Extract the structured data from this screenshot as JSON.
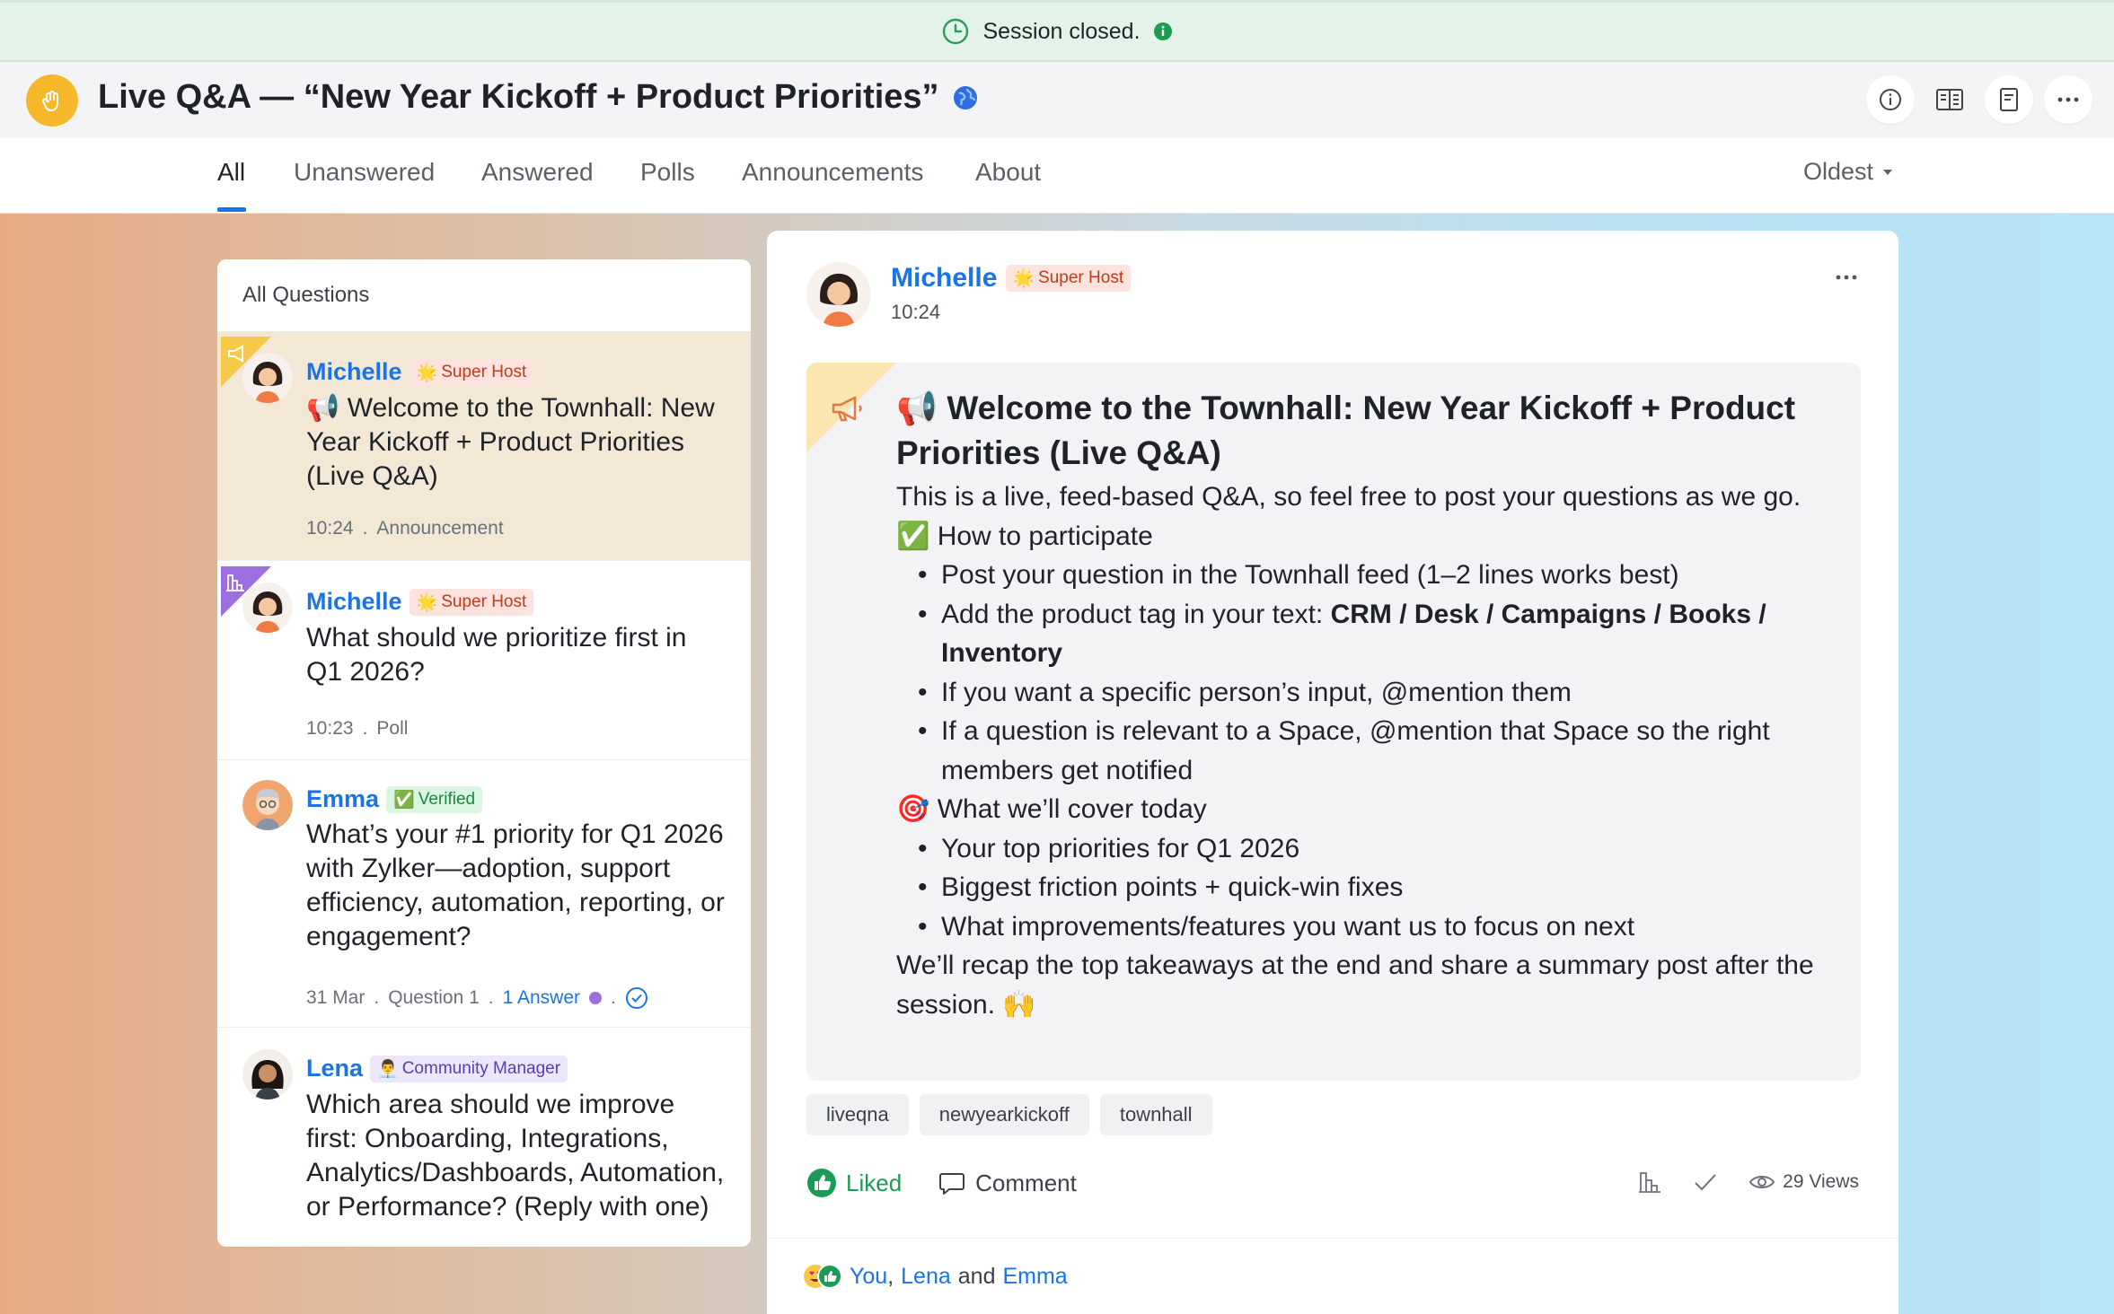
{
  "banner": {
    "text": "Session closed."
  },
  "header": {
    "title": "Live Q&A — “New Year Kickoff + Product Priorities”"
  },
  "tabs": [
    {
      "label": "All",
      "active": true
    },
    {
      "label": "Unanswered"
    },
    {
      "label": "Answered"
    },
    {
      "label": "Polls"
    },
    {
      "label": "Announcements"
    },
    {
      "label": "About"
    }
  ],
  "sort": {
    "label": "Oldest"
  },
  "questions_panel": {
    "heading": "All Questions",
    "items": [
      {
        "author": "Michelle",
        "badge": "Super Host",
        "text": "📢 Welcome to the Townhall: New Year Kickoff + Product Priorities (Live Q&A)",
        "time": "10:24",
        "type": "Announcement"
      },
      {
        "author": "Michelle",
        "badge": "Super Host",
        "text": "What should we prioritize first in Q1 2026?",
        "time": "10:23",
        "type": "Poll"
      },
      {
        "author": "Emma",
        "badge": "Verified",
        "text": "What’s your #1 priority for Q1 2026 with Zylker—adoption, support efficiency, automation, reporting, or engagement?",
        "time": "31 Mar",
        "type": "Question 1",
        "answers": "1 Answer"
      },
      {
        "author": "Lena",
        "badge": "Community Manager",
        "text": "Which area should we improve first: Onboarding, Integrations, Analytics/Dashboards, Automation, or Performance? (Reply with one)"
      }
    ]
  },
  "detail": {
    "author": "Michelle",
    "badge": "Super Host",
    "time": "10:24",
    "title": "📢 Welcome to the Townhall: New Year Kickoff + Product Priorities (Live Q&A)",
    "intro": "This is a live, feed-based Q&A, so feel free to post your questions as we go.",
    "participate_heading": "✅ How to participate",
    "participate_items": {
      "p1": "Post your question in the Townhall feed (1–2 lines works best)",
      "p2_prefix": "Add the product tag in your text: ",
      "p2_bold": "CRM / Desk / Campaigns / Books / Inventory",
      "p3": "If you want a specific person’s input, @mention them",
      "p4": "If a question is relevant to a Space, @mention that Space so the right members get notified"
    },
    "cover_heading": "🎯 What we’ll cover today",
    "cover_items": [
      "Your top priorities for Q1 2026",
      "Biggest friction points + quick-win fixes",
      "What improvements/features you want us to focus on next"
    ],
    "outro": "We’ll recap the top takeaways at the end and share a summary post after the session. 🙌",
    "tags": [
      "liveqna",
      "newyearkickoff",
      "townhall"
    ],
    "like_label": "Liked",
    "comment_label": "Comment",
    "views": "29 Views",
    "reactions": {
      "you": "You",
      "sep1": ",",
      "lena": "Lena",
      "and": "and",
      "emma": "Emma"
    }
  },
  "colors": {
    "accent": "#1a73e8",
    "liked": "#1c9a58",
    "banner_bg": "#e3f3ea",
    "selected_item": "#f3e8d6",
    "super_host_badge": "#fde3dd",
    "verified_badge": "#dcf4e2",
    "community_badge": "#ece6fa"
  },
  "icons": [
    "clock-icon",
    "info-icon",
    "app-logo-icon",
    "globe-icon",
    "megaphone-icon",
    "poll-icon",
    "check-circle-icon",
    "thumbs-up-icon",
    "comment-icon",
    "eye-icon",
    "more-icon"
  ]
}
